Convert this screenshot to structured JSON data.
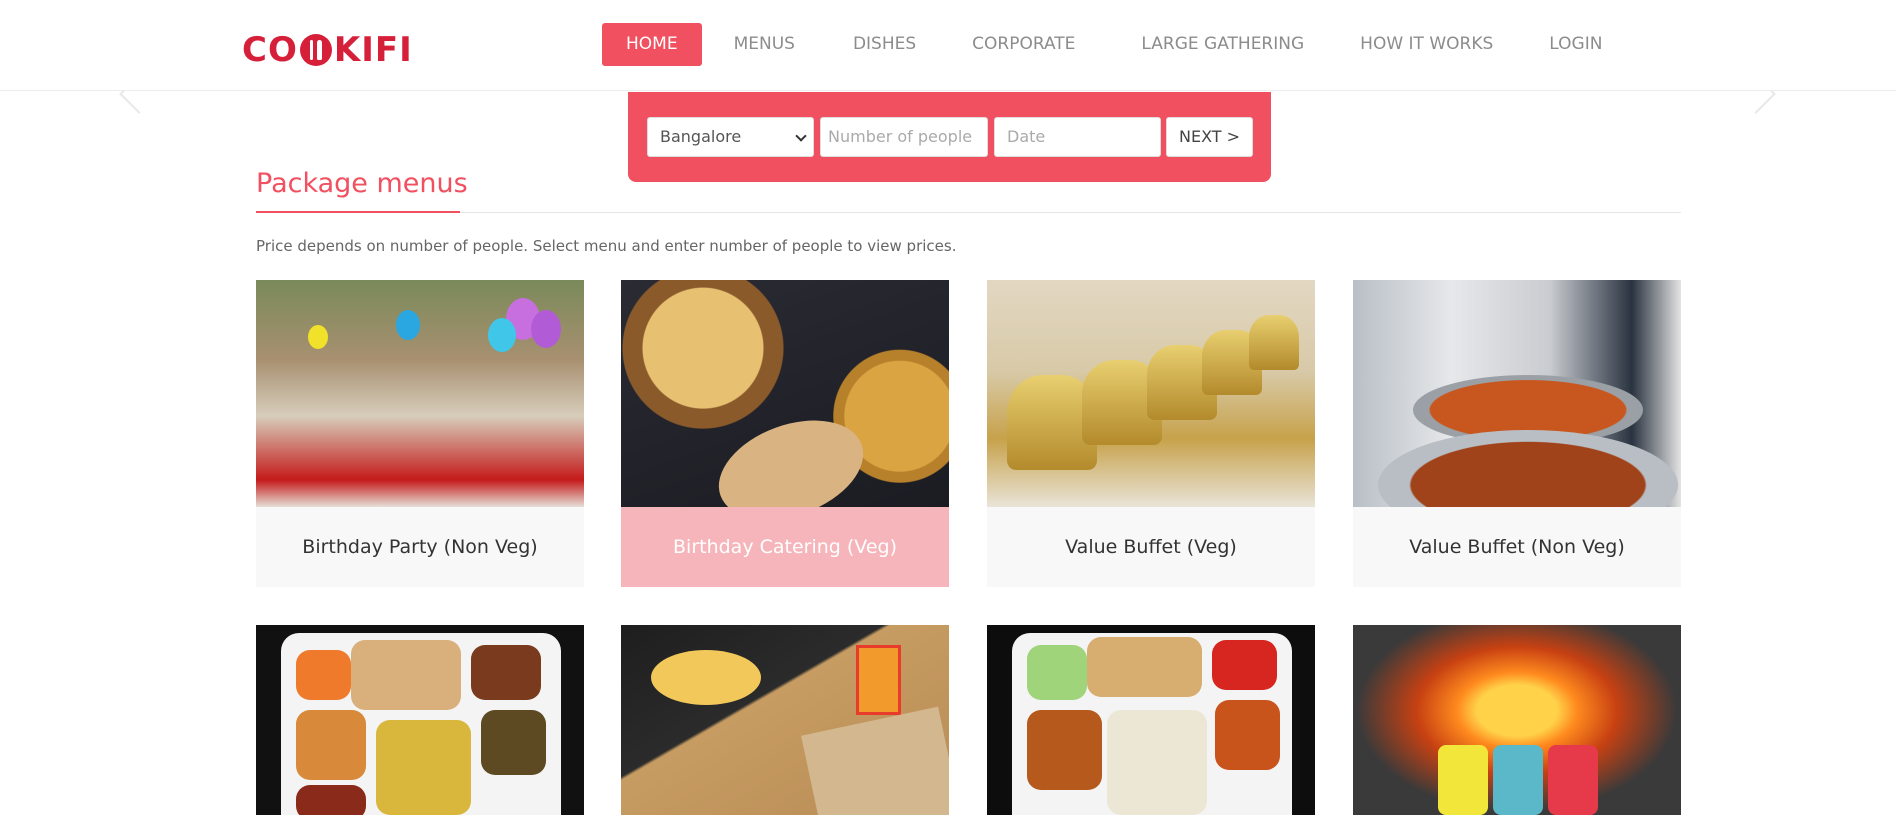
{
  "brand": {
    "logo_left": "CO",
    "logo_right": "KIFI",
    "accent_color": "#f0505f",
    "logo_color": "#d6203a"
  },
  "nav": {
    "items": [
      {
        "label": "HOME",
        "active": true
      },
      {
        "label": "MENUS",
        "active": false
      },
      {
        "label": "DISHES",
        "active": false
      },
      {
        "label": "CORPORATE",
        "active": false
      },
      {
        "label": "LARGE GATHERING",
        "active": false
      },
      {
        "label": "HOW IT WORKS",
        "active": false
      },
      {
        "label": "LOGIN",
        "active": false
      }
    ]
  },
  "search": {
    "city_value": "Bangalore",
    "people_placeholder": "Number of people",
    "date_placeholder": "Date",
    "next_label": "NEXT >"
  },
  "section": {
    "title": "Package menus",
    "description": "Price depends on number of people. Select menu and enter number of people to view prices."
  },
  "cards": [
    {
      "label": "Birthday Party (Non Veg)",
      "image": "catering-buffet-balloons-photo"
    },
    {
      "label": "Birthday Catering (Veg)",
      "image": "pizza-pasta-photo",
      "highlighted": true
    },
    {
      "label": "Value Buffet (Veg)",
      "image": "golden-chafing-dishes-photo"
    },
    {
      "label": "Value Buffet (Non Veg)",
      "image": "curry-buffet-photo"
    },
    {
      "label": "",
      "image": "thali-tray-photo"
    },
    {
      "label": "",
      "image": "snack-box-photo"
    },
    {
      "label": "",
      "image": "thali-tray-rice-photo"
    },
    {
      "label": "",
      "image": "flaming-drinks-photo"
    }
  ],
  "icons": [
    "chevron-left-icon",
    "chevron-right-icon",
    "chevron-down-icon"
  ]
}
